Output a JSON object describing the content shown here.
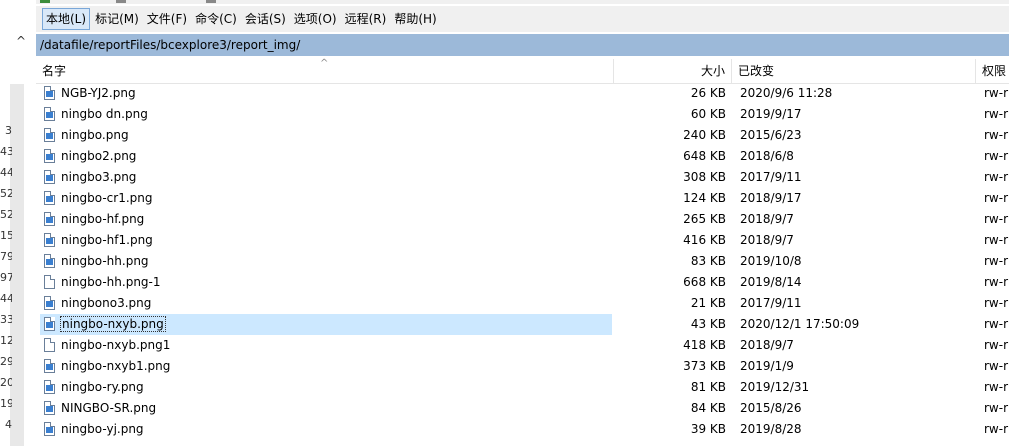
{
  "left_pane": {
    "chevron": "^",
    "numbers": [
      "3",
      "43",
      "44",
      "52",
      "52",
      "15",
      "79",
      "97",
      "44",
      "33",
      "12",
      "29",
      "20",
      "19",
      "4"
    ]
  },
  "menu": [
    "本地(L)",
    "标记(M)",
    "文件(F)",
    "命令(C)",
    "会话(S)",
    "选项(O)",
    "远程(R)",
    "帮助(H)"
  ],
  "path": "/datafile/reportFiles/bcexplore3/report_img/",
  "columns": {
    "name": "名字",
    "size": "大小",
    "modified": "已改变",
    "permissions": "权限"
  },
  "sort_indicator": "^",
  "files": [
    {
      "name": "NGB-YJ2.png",
      "size": "26 KB",
      "modified": "2020/9/6 11:28",
      "perm": "rw-r",
      "icon": "image-file-icon"
    },
    {
      "name": "ningbo dn.png",
      "size": "60 KB",
      "modified": "2019/9/17",
      "perm": "rw-r",
      "icon": "image-file-icon"
    },
    {
      "name": "ningbo.png",
      "size": "240 KB",
      "modified": "2015/6/23",
      "perm": "rw-r",
      "icon": "image-file-icon"
    },
    {
      "name": "ningbo2.png",
      "size": "648 KB",
      "modified": "2018/6/8",
      "perm": "rw-r",
      "icon": "image-file-icon"
    },
    {
      "name": "ningbo3.png",
      "size": "308 KB",
      "modified": "2017/9/11",
      "perm": "rw-r",
      "icon": "image-file-icon"
    },
    {
      "name": "ningbo-cr1.png",
      "size": "124 KB",
      "modified": "2018/9/17",
      "perm": "rw-r",
      "icon": "image-file-icon"
    },
    {
      "name": "ningbo-hf.png",
      "size": "265 KB",
      "modified": "2018/9/7",
      "perm": "rw-r",
      "icon": "image-file-icon"
    },
    {
      "name": "ningbo-hf1.png",
      "size": "416 KB",
      "modified": "2018/9/7",
      "perm": "rw-r",
      "icon": "image-file-icon"
    },
    {
      "name": "ningbo-hh.png",
      "size": "83 KB",
      "modified": "2019/10/8",
      "perm": "rw-r",
      "icon": "image-file-icon"
    },
    {
      "name": "ningbo-hh.png-1",
      "size": "668 KB",
      "modified": "2019/8/14",
      "perm": "rw-r",
      "icon": "file-icon"
    },
    {
      "name": "ningbono3.png",
      "size": "21 KB",
      "modified": "2017/9/11",
      "perm": "rw-r",
      "icon": "image-file-icon"
    },
    {
      "name": "ningbo-nxyb.png",
      "size": "43 KB",
      "modified": "2020/12/1 17:50:09",
      "perm": "rw-r",
      "icon": "image-file-icon",
      "selected": true
    },
    {
      "name": "ningbo-nxyb.png1",
      "size": "418 KB",
      "modified": "2018/9/7",
      "perm": "rw-r",
      "icon": "file-icon"
    },
    {
      "name": "ningbo-nxyb1.png",
      "size": "373 KB",
      "modified": "2019/1/9",
      "perm": "rw-r",
      "icon": "image-file-icon"
    },
    {
      "name": "ningbo-ry.png",
      "size": "81 KB",
      "modified": "2019/12/31",
      "perm": "rw-r",
      "icon": "image-file-icon"
    },
    {
      "name": "NINGBO-SR.png",
      "size": "84 KB",
      "modified": "2015/8/26",
      "perm": "rw-r",
      "icon": "image-file-icon"
    },
    {
      "name": "ningbo-yj.png",
      "size": "39 KB",
      "modified": "2019/8/28",
      "perm": "rw-r",
      "icon": "image-file-icon"
    }
  ],
  "colors": {
    "path_bar": "#9cb9d9",
    "selection": "#cce8ff",
    "menu_active": "#d9e8f8"
  }
}
